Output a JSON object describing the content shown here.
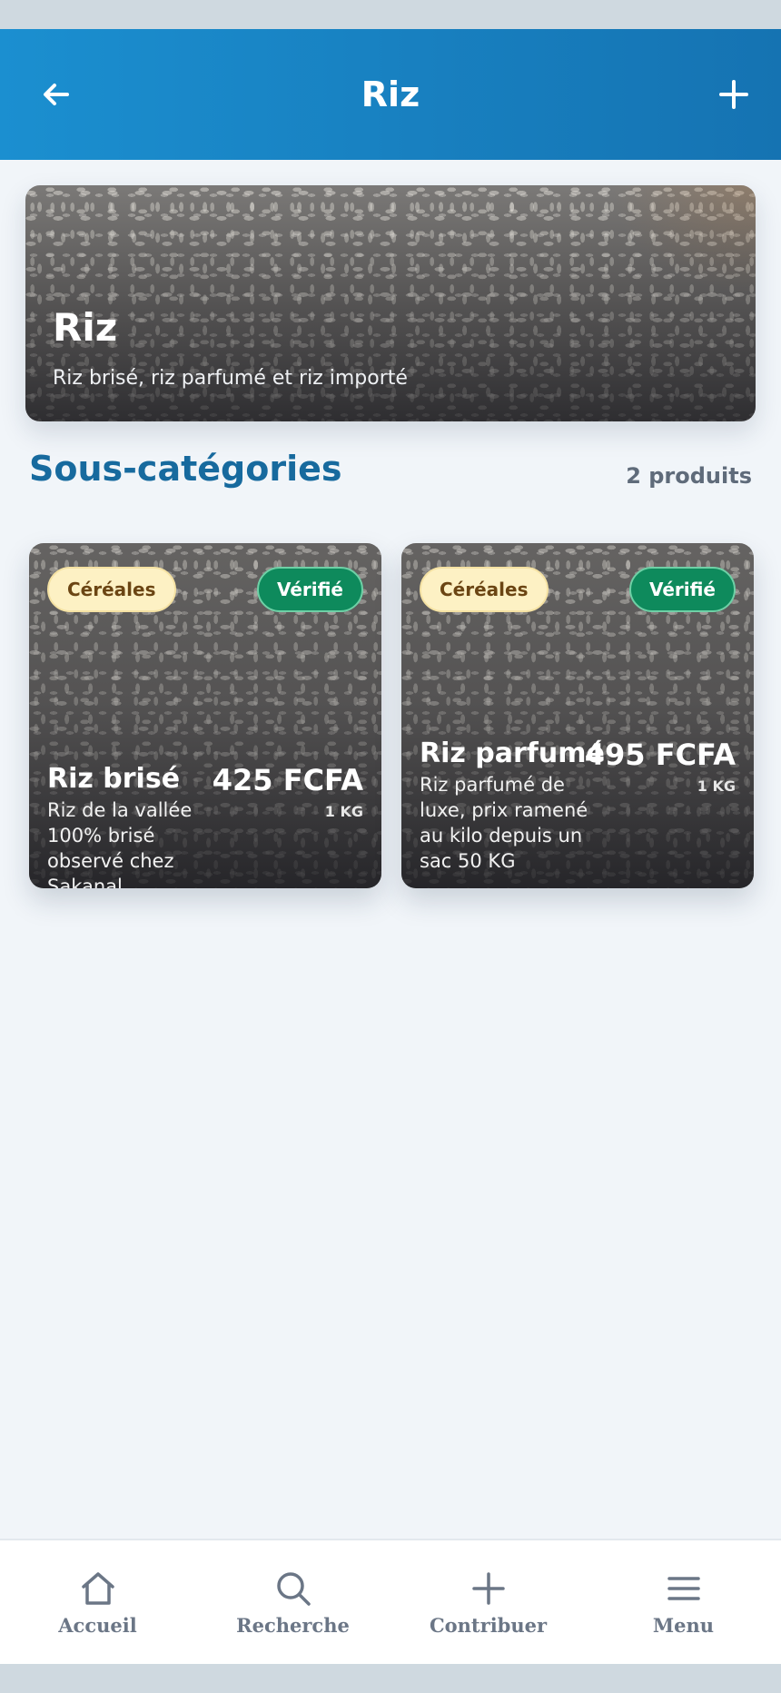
{
  "header": {
    "title": "Riz"
  },
  "hero": {
    "title": "Riz",
    "subtitle": "Riz brisé, riz parfumé et riz importé"
  },
  "section": {
    "title": "Sous-catégories",
    "count": "2 produits"
  },
  "products": [
    {
      "category": "Céréales",
      "status": "Vérifié",
      "name": "Riz brisé",
      "description": "Riz de la vallée 100% brisé observé chez Sakanal",
      "price": "425 FCFA",
      "unit": "1 KG"
    },
    {
      "category": "Céréales",
      "status": "Vérifié",
      "name": "Riz parfumé",
      "description": "Riz parfumé de luxe, prix ramené au kilo depuis un sac 50 KG",
      "price": "495 FCFA",
      "unit": "1 KG"
    }
  ],
  "nav": [
    {
      "label": "Accueil",
      "icon": "home-icon"
    },
    {
      "label": "Recherche",
      "icon": "search-icon"
    },
    {
      "label": "Contribuer",
      "icon": "plus-icon"
    },
    {
      "label": "Menu",
      "icon": "menu-icon"
    }
  ],
  "colors": {
    "header_start": "#1b8fd0",
    "header_end": "#1573b2",
    "section_title": "#176a9e",
    "verified_badge": "#0e8a5c",
    "category_badge": "#fdf1c4"
  }
}
